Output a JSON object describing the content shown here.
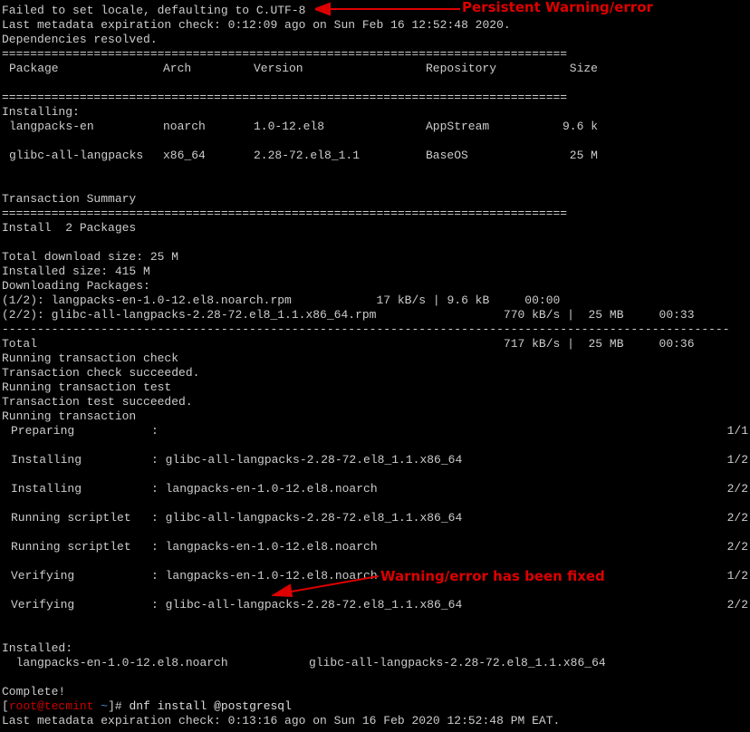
{
  "lines": [
    "Failed to set locale, defaulting to C.UTF-8",
    "Last metadata expiration check: 0:12:09 ago on Sun Feb 16 12:52:48 2020.",
    "Dependencies resolved."
  ],
  "sep80": "================================================================================",
  "sep103": "=======================================================================================================",
  "dash103": "-------------------------------------------------------------------------------------------------------",
  "headers": {
    "package": "Package",
    "arch": "Arch",
    "version": "Version",
    "repository": "Repository",
    "size": "Size"
  },
  "installing_label": "Installing:",
  "packages": [
    {
      "name": "langpacks-en",
      "arch": "noarch",
      "ver": "1.0-12.el8",
      "repo": "AppStream",
      "size": "9.6 k"
    },
    {
      "name": "glibc-all-langpacks",
      "arch": "x86_64",
      "ver": "2.28-72.el8_1.1",
      "repo": "BaseOS",
      "size": "25 M"
    }
  ],
  "tx_summary": "Transaction Summary",
  "install_count": "Install  2 Packages",
  "sizes": [
    "Total download size: 25 M",
    "Installed size: 415 M",
    "Downloading Packages:"
  ],
  "downloads": [
    "(1/2): langpacks-en-1.0-12.el8.noarch.rpm            17 kB/s | 9.6 kB     00:00",
    "(2/2): glibc-all-langpacks-2.28-72.el8_1.1.x86_64.rpm                  770 kB/s |  25 MB     00:33"
  ],
  "total": "Total                                                                  717 kB/s |  25 MB     00:36",
  "running": [
    "Running transaction check",
    "Transaction check succeeded.",
    "Running transaction test",
    "Transaction test succeeded.",
    "Running transaction"
  ],
  "progress": [
    {
      "l": "Preparing",
      "v": ":",
      "p": "1/1"
    },
    {
      "l": "Installing",
      "v": ": glibc-all-langpacks-2.28-72.el8_1.1.x86_64",
      "p": "1/2"
    },
    {
      "l": "Installing",
      "v": ": langpacks-en-1.0-12.el8.noarch",
      "p": "2/2"
    },
    {
      "l": "Running scriptlet",
      "v": ": glibc-all-langpacks-2.28-72.el8_1.1.x86_64",
      "p": "2/2"
    },
    {
      "l": "Running scriptlet",
      "v": ": langpacks-en-1.0-12.el8.noarch",
      "p": "2/2"
    },
    {
      "l": "Verifying",
      "v": ": langpacks-en-1.0-12.el8.noarch",
      "p": "1/2"
    },
    {
      "l": "Verifying",
      "v": ": glibc-all-langpacks-2.28-72.el8_1.1.x86_64",
      "p": "2/2"
    }
  ],
  "installed_label": "Installed:",
  "installed": [
    "langpacks-en-1.0-12.el8.noarch",
    "glibc-all-langpacks-2.28-72.el8_1.1.x86_64"
  ],
  "complete": "Complete!",
  "prompt": {
    "user_host": "root@tecmint",
    "tilde": "~",
    "command": "dnf install @postgresql"
  },
  "last_line": "Last metadata expiration check: 0:13:16 ago on Sun 16 Feb 2020 12:52:48 PM EAT.",
  "annot1": "Persistent Warning/error",
  "annot2": "Warning/error has been fixed"
}
